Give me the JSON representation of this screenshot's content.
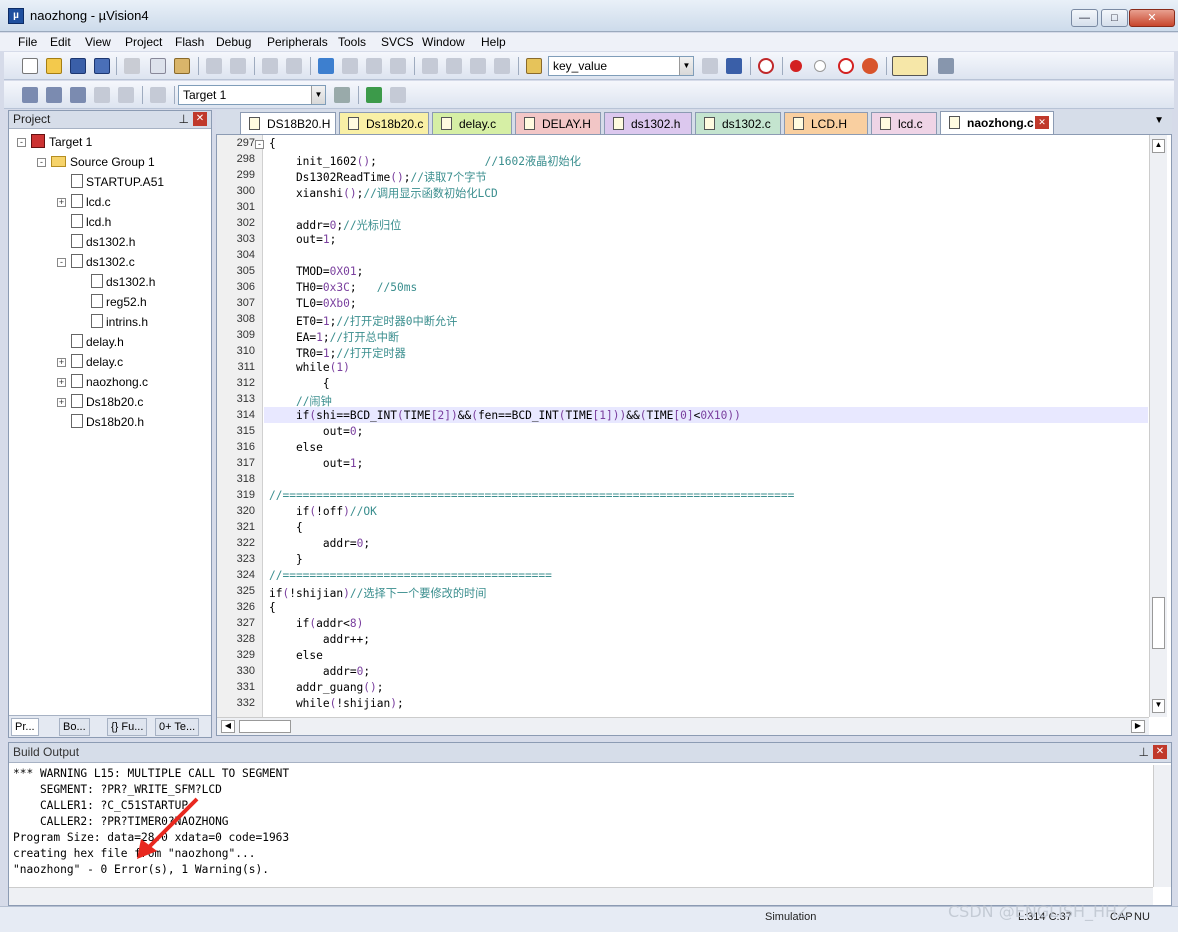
{
  "window": {
    "title": "naozhong  - µVision4",
    "app_icon": "µ"
  },
  "menu": [
    "File",
    "Edit",
    "View",
    "Project",
    "Flash",
    "Debug",
    "Peripherals",
    "Tools",
    "SVCS",
    "Window",
    "Help"
  ],
  "toolbar": {
    "find_combo": "key_value",
    "target_combo": "Target 1"
  },
  "project": {
    "header": "Project",
    "tree": [
      {
        "label": "Target 1",
        "kind": "target",
        "depth": 0
      },
      {
        "label": "Source Group 1",
        "kind": "folder",
        "depth": 1
      },
      {
        "label": "STARTUP.A51",
        "kind": "file",
        "depth": 2
      },
      {
        "label": "lcd.c",
        "kind": "file",
        "depth": 2,
        "expander": "+"
      },
      {
        "label": "lcd.h",
        "kind": "file",
        "depth": 2
      },
      {
        "label": "ds1302.h",
        "kind": "file",
        "depth": 2
      },
      {
        "label": "ds1302.c",
        "kind": "file",
        "depth": 2,
        "expander": "-"
      },
      {
        "label": "ds1302.h",
        "kind": "file",
        "depth": 3
      },
      {
        "label": "reg52.h",
        "kind": "file",
        "depth": 3
      },
      {
        "label": "intrins.h",
        "kind": "file",
        "depth": 3
      },
      {
        "label": "delay.h",
        "kind": "file",
        "depth": 2
      },
      {
        "label": "delay.c",
        "kind": "file",
        "depth": 2,
        "expander": "+"
      },
      {
        "label": "naozhong.c",
        "kind": "file",
        "depth": 2,
        "expander": "+"
      },
      {
        "label": "Ds18b20.c",
        "kind": "file",
        "depth": 2,
        "expander": "+"
      },
      {
        "label": "Ds18b20.h",
        "kind": "file",
        "depth": 2
      }
    ],
    "tabs": [
      "Pr...",
      "Bo...",
      "{} Fu...",
      "0+ Te..."
    ]
  },
  "editor_tabs": [
    {
      "label": "DS18B20.H",
      "color": "#ffffff"
    },
    {
      "label": "Ds18b20.c",
      "color": "#f9f0a6"
    },
    {
      "label": "delay.c",
      "color": "#d6efa5"
    },
    {
      "label": "DELAY.H",
      "color": "#f2c6c6"
    },
    {
      "label": "ds1302.h",
      "color": "#dcc8ee"
    },
    {
      "label": "ds1302.c",
      "color": "#c4e4cf"
    },
    {
      "label": "LCD.H",
      "color": "#f9cfa0"
    },
    {
      "label": "lcd.c",
      "color": "#efd4e6"
    },
    {
      "label": "naozhong.c",
      "color": "#ffffff",
      "active": true
    }
  ],
  "code": [
    {
      "n": "297",
      "t": "{"
    },
    {
      "n": "298",
      "t": "    init_1602();                //1602液晶初始化"
    },
    {
      "n": "299",
      "t": "    Ds1302ReadTime();//读取7个字节"
    },
    {
      "n": "300",
      "t": "    xianshi();//调用显示函数初始化LCD"
    },
    {
      "n": "301",
      "t": ""
    },
    {
      "n": "302",
      "t": "    addr=0;//光标归位"
    },
    {
      "n": "303",
      "t": "    out=1;"
    },
    {
      "n": "304",
      "t": ""
    },
    {
      "n": "305",
      "t": "    TMOD=0X01;"
    },
    {
      "n": "306",
      "t": "    TH0=0x3C;   //50ms"
    },
    {
      "n": "307",
      "t": "    TL0=0Xb0;"
    },
    {
      "n": "308",
      "t": "    ET0=1;//打开定时器0中断允许"
    },
    {
      "n": "309",
      "t": "    EA=1;//打开总中断"
    },
    {
      "n": "310",
      "t": "    TR0=1;//打开定时器"
    },
    {
      "n": "311",
      "t": "    while(1)"
    },
    {
      "n": "312",
      "t": "        {"
    },
    {
      "n": "313",
      "t": "    //闹钟"
    },
    {
      "n": "314",
      "t": "    if(shi==BCD_INT(TIME[2])&&(fen==BCD_INT(TIME[1]))&&(TIME[0]<0X10))"
    },
    {
      "n": "315",
      "t": "        out=0;"
    },
    {
      "n": "316",
      "t": "    else"
    },
    {
      "n": "317",
      "t": "        out=1;"
    },
    {
      "n": "318",
      "t": ""
    },
    {
      "n": "319",
      "t": "//============================================================================"
    },
    {
      "n": "320",
      "t": "    if(!off)//OK"
    },
    {
      "n": "321",
      "t": "    {"
    },
    {
      "n": "322",
      "t": "        addr=0;"
    },
    {
      "n": "323",
      "t": "    }"
    },
    {
      "n": "324",
      "t": "//========================================"
    },
    {
      "n": "325",
      "t": "if(!shijian)//选择下一个要修改的时间"
    },
    {
      "n": "326",
      "t": "{"
    },
    {
      "n": "327",
      "t": "    if(addr<8)"
    },
    {
      "n": "328",
      "t": "        addr++;"
    },
    {
      "n": "329",
      "t": "    else"
    },
    {
      "n": "330",
      "t": "        addr=0;"
    },
    {
      "n": "331",
      "t": "    addr_guang();"
    },
    {
      "n": "332",
      "t": "    while(!shijian);"
    }
  ],
  "build": {
    "header": "Build Output",
    "lines": [
      "*** WARNING L15: MULTIPLE CALL TO SEGMENT",
      "    SEGMENT: ?PR?_WRITE_SFM?LCD",
      "    CALLER1: ?C_C51STARTUP",
      "    CALLER2: ?PR?TIMER0?NAOZHONG",
      "Program Size: data=28.0 xdata=0 code=1963",
      "creating hex file from \"naozhong\"...",
      "\"naozhong\" - 0 Error(s), 1 Warning(s)."
    ]
  },
  "status": {
    "mode": "Simulation",
    "position": "L:314 C:37",
    "cap": "CAP",
    "num": "NU"
  },
  "watermark": "CSDN @ENGLISH_HHZ"
}
